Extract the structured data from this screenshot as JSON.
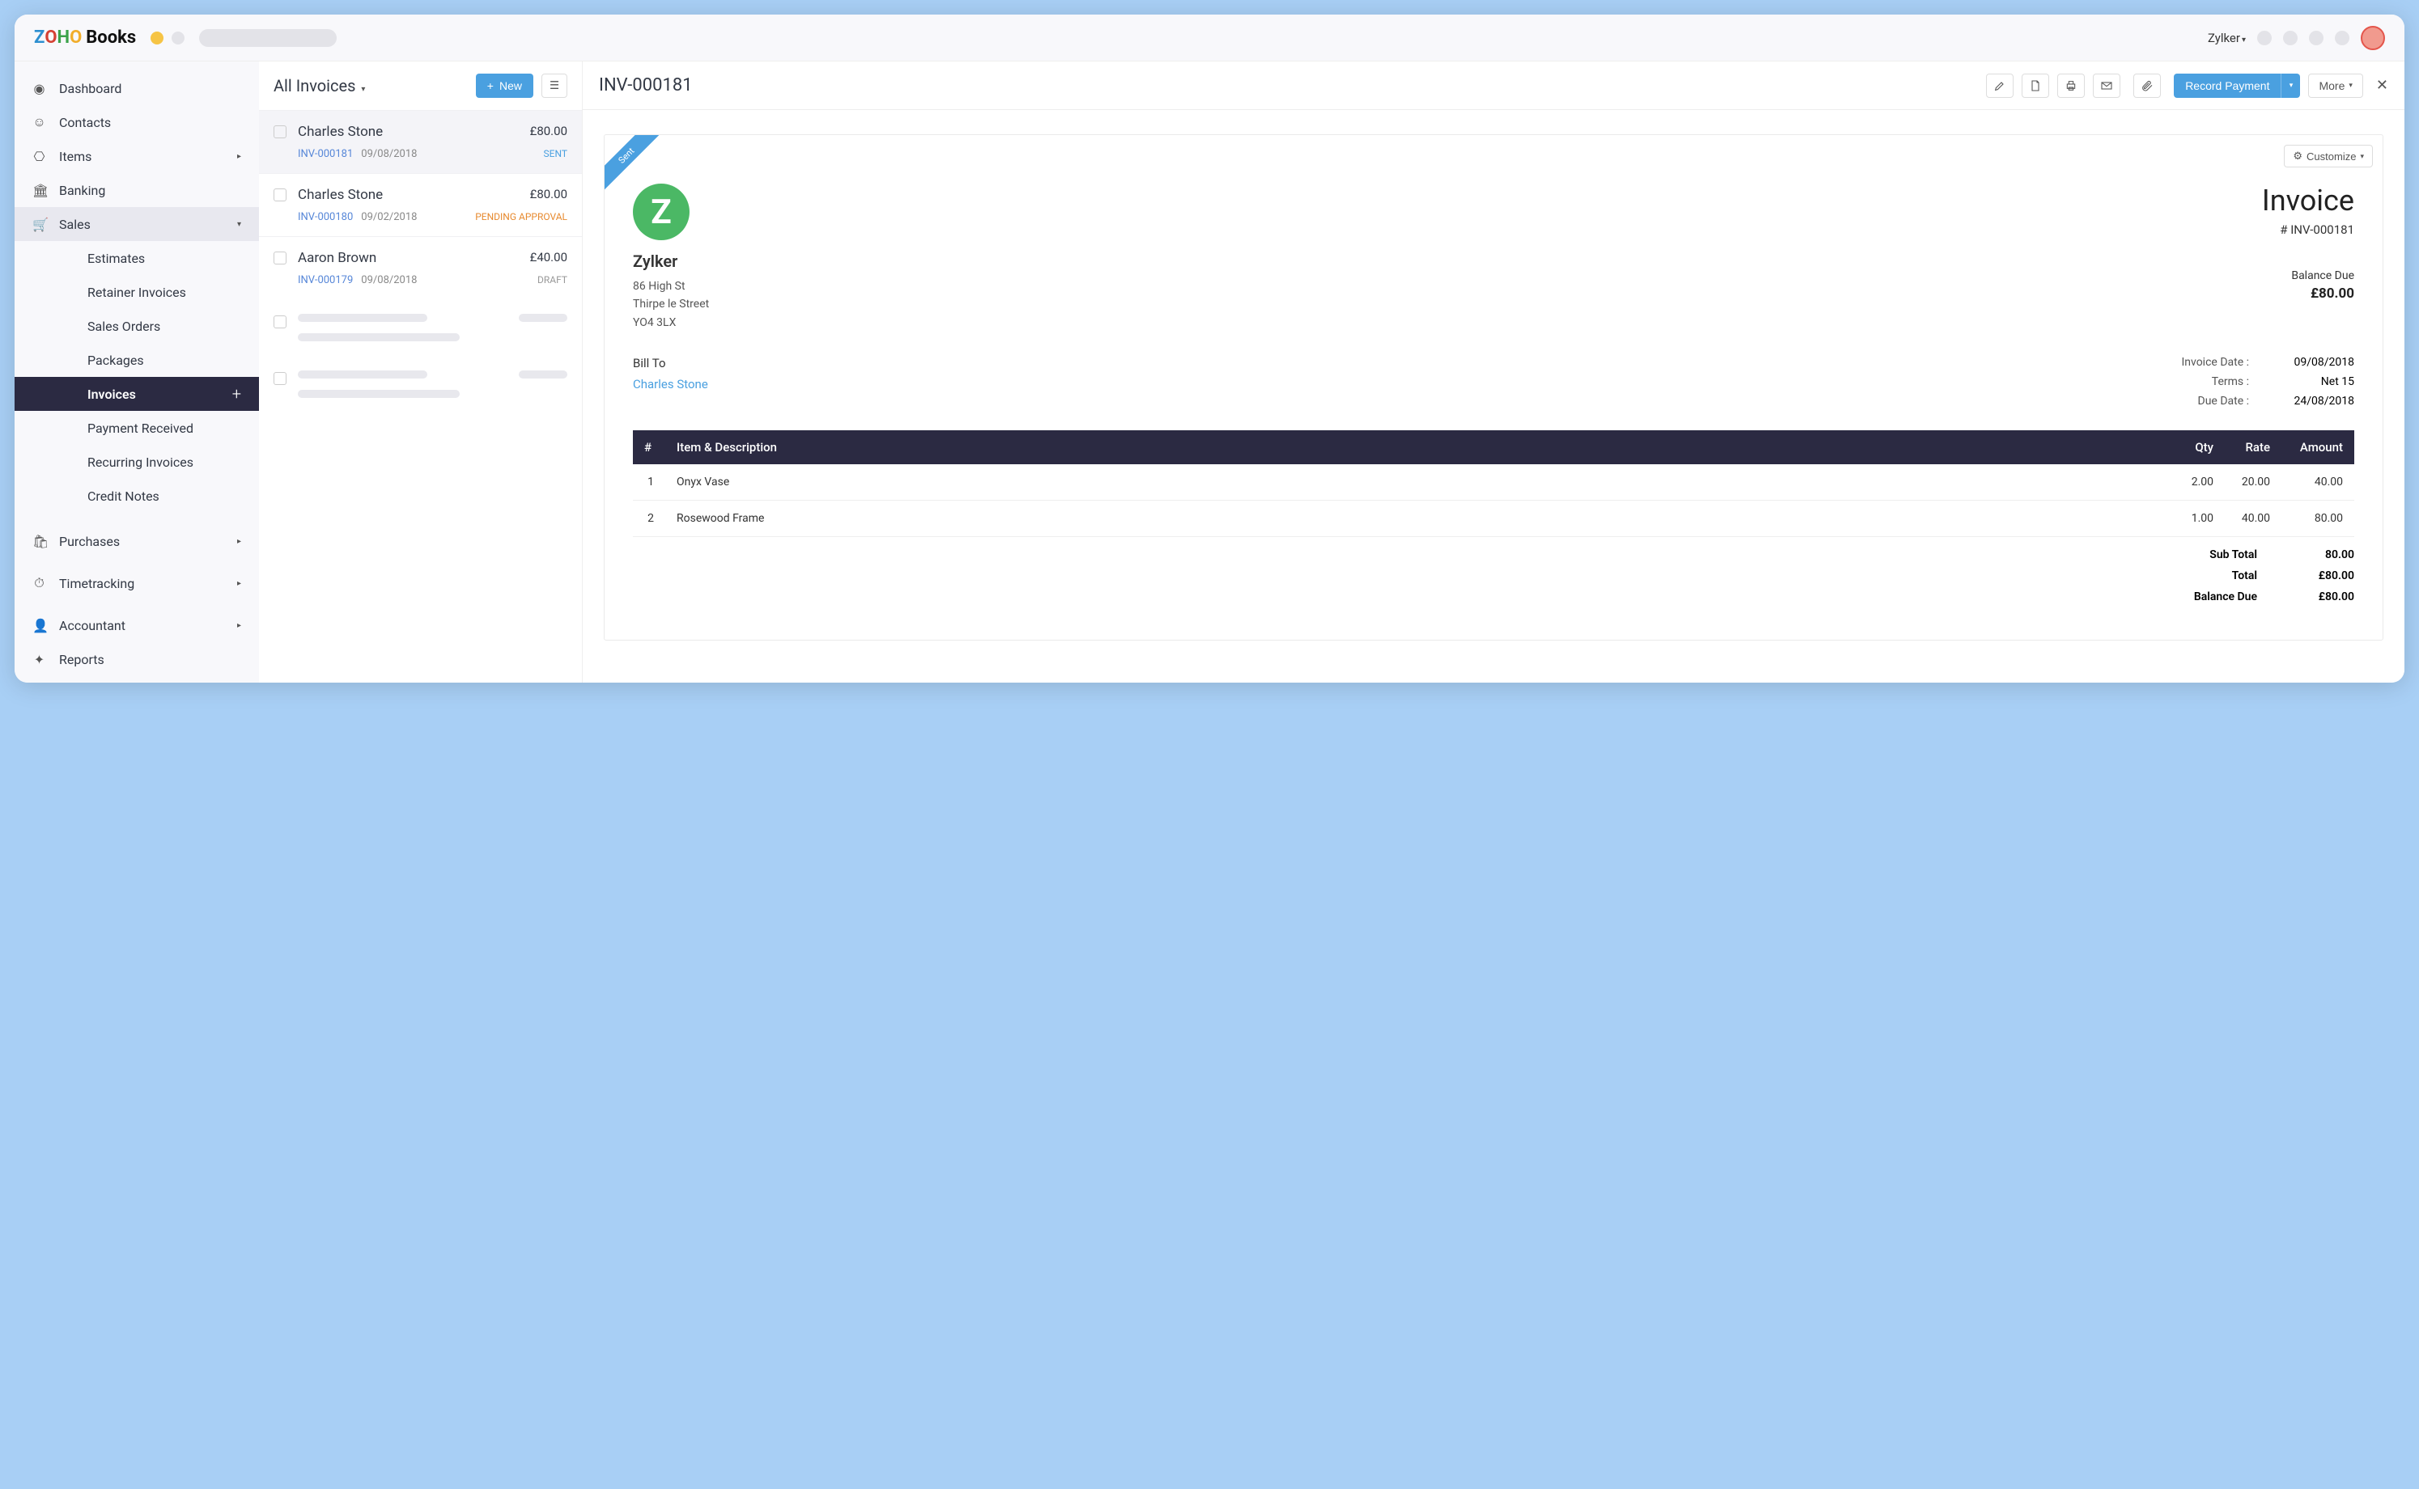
{
  "brand": {
    "logo_text": "Books"
  },
  "topbar": {
    "org": "Zylker"
  },
  "sidebar": {
    "dashboard": "Dashboard",
    "contacts": "Contacts",
    "items": "Items",
    "banking": "Banking",
    "sales": "Sales",
    "sales_sub": {
      "estimates": "Estimates",
      "retainer": "Retainer Invoices",
      "sales_orders": "Sales Orders",
      "packages": "Packages",
      "invoices": "Invoices",
      "payment_received": "Payment Received",
      "recurring_invoices": "Recurring Invoices",
      "credit_notes": "Credit Notes"
    },
    "purchases": "Purchases",
    "timetracking": "Timetracking",
    "accountant": "Accountant",
    "reports": "Reports"
  },
  "list": {
    "title": "All Invoices",
    "new_label": "New",
    "rows": [
      {
        "name": "Charles Stone",
        "amount": "£80.00",
        "id": "INV-000181",
        "date": "09/08/2018",
        "status": "SENT",
        "status_class": "status-sent"
      },
      {
        "name": "Charles Stone",
        "amount": "£80.00",
        "id": "INV-000180",
        "date": "09/02/2018",
        "status": "PENDING APPROVAL",
        "status_class": "status-pending"
      },
      {
        "name": "Aaron Brown",
        "amount": "£40.00",
        "id": "INV-000179",
        "date": "09/08/2018",
        "status": "DRAFT",
        "status_class": "status-draft"
      }
    ]
  },
  "detail": {
    "title": "INV-000181",
    "record_payment": "Record Payment",
    "more": "More",
    "customize": "Customize",
    "ribbon": "Sent",
    "company": {
      "name": "Zylker",
      "addr1": "86 High St",
      "addr2": "Thirpe le Street",
      "addr3": "YO4 3LX"
    },
    "doc_title": "Invoice",
    "doc_number": "# INV-000181",
    "balance_due_label": "Balance Due",
    "balance_due": "£80.00",
    "bill_to_label": "Bill To",
    "bill_to_name": "Charles Stone",
    "meta": {
      "invoice_date_label": "Invoice Date :",
      "invoice_date": "09/08/2018",
      "terms_label": "Terms :",
      "terms": "Net 15",
      "due_date_label": "Due Date :",
      "due_date": "24/08/2018"
    },
    "table": {
      "h_num": "#",
      "h_item": "Item & Description",
      "h_qty": "Qty",
      "h_rate": "Rate",
      "h_amount": "Amount"
    },
    "lines": [
      {
        "num": "1",
        "item": "Onyx Vase",
        "qty": "2.00",
        "rate": "20.00",
        "amount": "40.00"
      },
      {
        "num": "2",
        "item": "Rosewood Frame",
        "qty": "1.00",
        "rate": "40.00",
        "amount": "80.00"
      }
    ],
    "totals": {
      "sub_total_label": "Sub Total",
      "sub_total": "80.00",
      "total_label": "Total",
      "total": "£80.00",
      "balance_due_label": "Balance Due",
      "balance_due": "£80.00"
    }
  }
}
